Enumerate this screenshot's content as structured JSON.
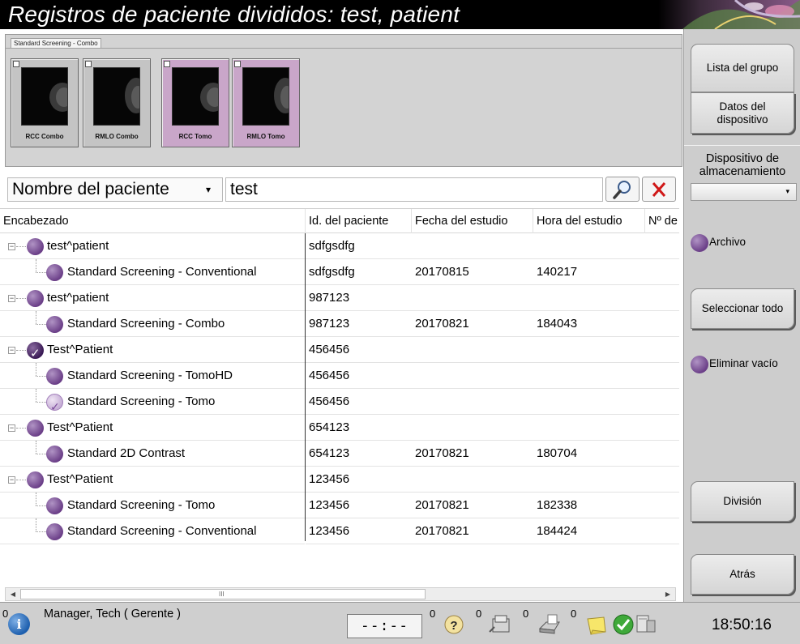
{
  "window": {
    "title": "Registros de paciente divididos: test, patient"
  },
  "series": {
    "tab_label": "Standard Screening - Combo",
    "thumbnails": [
      {
        "label": "RCC Combo",
        "selected": false
      },
      {
        "label": "RMLO Combo",
        "selected": false
      },
      {
        "label": "RCC Tomo",
        "selected": true
      },
      {
        "label": "RMLO Tomo",
        "selected": true
      }
    ]
  },
  "search": {
    "field_label": "Nombre del paciente",
    "query": "test",
    "search_icon": "magnifier-icon",
    "clear_icon": "red-x-icon"
  },
  "table": {
    "columns": [
      "Encabezado",
      "Id. del paciente",
      "Fecha del estudio",
      "Hora del estudio",
      "Nº de"
    ],
    "rows": [
      {
        "level": 0,
        "icon": "normal",
        "name": "test^patient",
        "patient_id": "sdfgsdfg",
        "date": "",
        "time": ""
      },
      {
        "level": 1,
        "icon": "normal",
        "name": "Standard Screening - Conventional",
        "patient_id": "sdfgsdfg",
        "date": "20170815",
        "time": "140217"
      },
      {
        "level": 0,
        "icon": "normal",
        "name": "test^patient",
        "patient_id": "987123",
        "date": "",
        "time": ""
      },
      {
        "level": 1,
        "icon": "normal",
        "name": "Standard Screening - Combo",
        "patient_id": "987123",
        "date": "20170821",
        "time": "184043"
      },
      {
        "level": 0,
        "icon": "checked",
        "name": "Test^Patient",
        "patient_id": "456456",
        "date": "",
        "time": ""
      },
      {
        "level": 1,
        "icon": "normal",
        "name": "Standard Screening - TomoHD",
        "patient_id": "456456",
        "date": "",
        "time": ""
      },
      {
        "level": 1,
        "icon": "light-checked",
        "name": "Standard Screening - Tomo",
        "patient_id": "456456",
        "date": "",
        "time": ""
      },
      {
        "level": 0,
        "icon": "normal",
        "name": "Test^Patient",
        "patient_id": "654123",
        "date": "",
        "time": ""
      },
      {
        "level": 1,
        "icon": "normal",
        "name": "Standard 2D Contrast",
        "patient_id": "654123",
        "date": "20170821",
        "time": "180704"
      },
      {
        "level": 0,
        "icon": "normal",
        "name": "Test^Patient",
        "patient_id": "123456",
        "date": "",
        "time": ""
      },
      {
        "level": 1,
        "icon": "normal",
        "name": "Standard Screening - Tomo",
        "patient_id": "123456",
        "date": "20170821",
        "time": "182338"
      },
      {
        "level": 1,
        "icon": "normal",
        "name": "Standard Screening - Conventional",
        "patient_id": "123456",
        "date": "20170821",
        "time": "184424"
      }
    ]
  },
  "scrollbar": {
    "grip": "III"
  },
  "right_panel": {
    "group_list_label": "Lista del grupo",
    "device_data_label": "Datos del dispositivo",
    "storage_label": "Dispositivo de almacenamiento",
    "storage_value": "",
    "archive_label": "Archivo",
    "select_all_label": "Seleccionar todo",
    "delete_empty_label": "Eliminar vacío",
    "split_label": "División",
    "back_label": "Atrás"
  },
  "status_bar": {
    "info_count": "0",
    "user": "Manager, Tech ( Gerente )",
    "clock_placeholder": "--:--",
    "help_count": "0",
    "queue_count": "0",
    "print_count": "0",
    "notes_count": "0",
    "time": "18:50:16"
  },
  "colors": {
    "accent_purple": "#6b3f88",
    "selected_thumb": "#c9a6c9",
    "panel_gray": "#cdcdcd"
  }
}
